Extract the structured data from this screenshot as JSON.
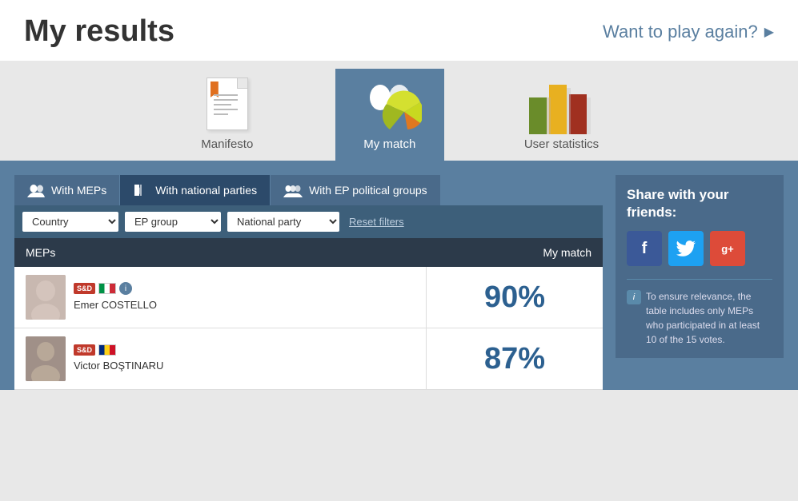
{
  "header": {
    "title": "My results",
    "play_again": "Want to play again?",
    "play_again_arrow": "▶"
  },
  "nav": {
    "items": [
      {
        "id": "manifesto",
        "label": "Manifesto",
        "active": false
      },
      {
        "id": "my-match",
        "label": "My match",
        "active": true
      },
      {
        "id": "user-statistics",
        "label": "User statistics",
        "active": false
      }
    ]
  },
  "tabs": [
    {
      "id": "meps",
      "label": "With MEPs",
      "active": false
    },
    {
      "id": "national-parties",
      "label": "With national parties",
      "active": true
    },
    {
      "id": "ep-groups",
      "label": "With EP political groups",
      "active": false
    }
  ],
  "filters": {
    "country_label": "Country",
    "ep_group_label": "EP group",
    "national_party_label": "National party",
    "reset_label": "Reset filters"
  },
  "table": {
    "col_meps": "MEPs",
    "col_match": "My match"
  },
  "meps": [
    {
      "name": "Emer COSTELLO",
      "party_badge": "S&D",
      "flag": "it",
      "match": "90%"
    },
    {
      "name": "Victor BOŞTINARU",
      "party_badge": "S&D",
      "flag": "ro",
      "match": "87%"
    }
  ],
  "share": {
    "title": "Share with your friends:",
    "facebook": "f",
    "twitter": "t",
    "googleplus": "g+"
  },
  "info": {
    "text": "To ensure relevance, the table includes only MEPs who participated in at least 10 of the 15 votes."
  }
}
